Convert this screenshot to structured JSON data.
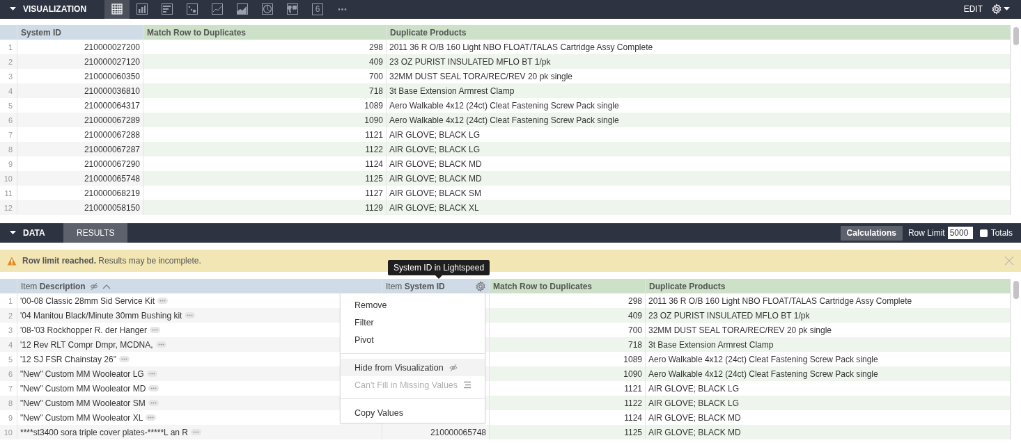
{
  "visualization": {
    "title": "VISUALIZATION",
    "expanded": true,
    "toolbar": [
      {
        "kind": "table",
        "selected": true
      },
      {
        "kind": "column",
        "selected": false
      },
      {
        "kind": "bar",
        "selected": false
      },
      {
        "kind": "scatter",
        "selected": false
      },
      {
        "kind": "line",
        "selected": false
      },
      {
        "kind": "area",
        "selected": false
      },
      {
        "kind": "pie",
        "selected": false
      },
      {
        "kind": "map",
        "selected": false
      },
      {
        "kind": "single_value",
        "label": "6",
        "selected": false
      },
      {
        "kind": "more",
        "label": "•••",
        "selected": false
      }
    ],
    "edit_label": "EDIT"
  },
  "visualization_table": {
    "columns": [
      {
        "label": "System ID",
        "kind": "dimension"
      },
      {
        "label": "Match Row to Duplicates",
        "kind": "measure"
      },
      {
        "label": "Duplicate Products",
        "kind": "measure"
      }
    ],
    "rows": [
      {
        "number": "1",
        "cells": [
          "210000027200",
          "298",
          "2011 36 R O/B 160 Light NBO FLOAT/TALAS Cartridge Assy Complete"
        ]
      },
      {
        "number": "2",
        "cells": [
          "210000027120",
          "409",
          "23 OZ PURIST INSULATED MFLO BT 1/pk"
        ]
      },
      {
        "number": "3",
        "cells": [
          "210000060350",
          "700",
          "32MM DUST SEAL TORA/REC/REV 20 pk single"
        ]
      },
      {
        "number": "4",
        "cells": [
          "210000036810",
          "718",
          "3t Base Extension Armrest Clamp"
        ]
      },
      {
        "number": "5",
        "cells": [
          "210000064317",
          "1089",
          "Aero Walkable 4x12 (24ct) Cleat Fastening Screw Pack single"
        ]
      },
      {
        "number": "6",
        "cells": [
          "210000067289",
          "1090",
          "Aero Walkable 4x12 (24ct) Cleat Fastening Screw Pack single"
        ]
      },
      {
        "number": "7",
        "cells": [
          "210000067288",
          "1121",
          "AIR GLOVE; BLACK LG"
        ]
      },
      {
        "number": "8",
        "cells": [
          "210000067287",
          "1122",
          "AIR GLOVE; BLACK LG"
        ]
      },
      {
        "number": "9",
        "cells": [
          "210000067290",
          "1124",
          "AIR GLOVE; BLACK MD"
        ]
      },
      {
        "number": "10",
        "cells": [
          "210000065748",
          "1125",
          "AIR GLOVE; BLACK MD"
        ]
      },
      {
        "number": "11",
        "cells": [
          "210000068219",
          "1127",
          "AIR GLOVE; BLACK SM"
        ]
      },
      {
        "number": "12",
        "cells": [
          "210000058150",
          "1129",
          "AIR GLOVE; BLACK XL"
        ]
      }
    ]
  },
  "data_panel": {
    "title": "DATA",
    "expanded": true,
    "tabs": [
      {
        "label": "RESULTS",
        "selected": true
      }
    ],
    "calculations_button": "Calculations",
    "row_limit": {
      "label": "Row Limit",
      "value": "5000"
    },
    "totals": {
      "label": "Totals",
      "checked": false
    }
  },
  "banner": {
    "text": "**Row limit reached.** Results may be incomplete."
  },
  "tooltip": "System ID in Lightspeed",
  "results_table": {
    "columns": [
      {
        "label": "Item **Description**",
        "kind": "dimension",
        "hidden_in_visualization": true,
        "sort_ascending": true,
        "detail_menu": true
      },
      {
        "label": "Item **System ID**",
        "kind": "dimension",
        "settings_shown": true
      },
      {
        "label": "Match Row to Duplicates",
        "kind": "measure"
      },
      {
        "label": "Duplicate Products",
        "kind": "measure"
      }
    ],
    "rows": [
      {
        "number": "1",
        "cells": [
          "'00-08 Classic 28mm Sid Service Kit",
          null,
          "298",
          "2011 36 R O/B 160 Light NBO FLOAT/TALAS Cartridge Assy Complete"
        ]
      },
      {
        "number": "2",
        "cells": [
          "'04 Manitou Black/Minute 30mm Bushing kit",
          null,
          "409",
          "23 OZ PURIST INSULATED MFLO BT 1/pk"
        ]
      },
      {
        "number": "3",
        "cells": [
          "'08-'03 Rockhopper R. der Hanger",
          null,
          "700",
          "32MM DUST SEAL TORA/REC/REV 20 pk single"
        ]
      },
      {
        "number": "4",
        "cells": [
          "'12 Rev RLT Compr Dmpr, MCDNA,",
          null,
          "718",
          "3t Base Extension Armrest Clamp"
        ]
      },
      {
        "number": "5",
        "cells": [
          "'12 SJ FSR Chainstay 26\"",
          null,
          "1089",
          "Aero Walkable 4x12 (24ct) Cleat Fastening Screw Pack single"
        ]
      },
      {
        "number": "6",
        "cells": [
          "\"New\" Custom MM Wooleator LG",
          null,
          "1090",
          "Aero Walkable 4x12 (24ct) Cleat Fastening Screw Pack single"
        ]
      },
      {
        "number": "7",
        "cells": [
          "\"New\" Custom MM Wooleator MD",
          null,
          "1121",
          "AIR GLOVE; BLACK LG"
        ]
      },
      {
        "number": "8",
        "cells": [
          "\"New\" Custom MM Wooleator SM",
          null,
          "1122",
          "AIR GLOVE; BLACK LG"
        ]
      },
      {
        "number": "9",
        "cells": [
          "\"New\" Custom MM Wooleator XL",
          null,
          "1124",
          "AIR GLOVE; BLACK MD"
        ]
      },
      {
        "number": "10",
        "cells": [
          "****st3400 sora triple cover plates-*****L an R",
          "210000065748",
          "1125",
          "AIR GLOVE; BLACK MD"
        ]
      }
    ]
  },
  "context_menu": {
    "items": [
      {
        "kind": "item",
        "label": "Remove",
        "highlighted": false,
        "disabled": false
      },
      {
        "kind": "item",
        "label": "Filter",
        "highlighted": false,
        "disabled": false
      },
      {
        "kind": "item",
        "label": "Pivot",
        "highlighted": false,
        "disabled": false
      },
      {
        "kind": "divider"
      },
      {
        "kind": "eye_item",
        "label": "Hide from Visualization",
        "highlighted": true,
        "disabled": false
      },
      {
        "kind": "lines_item",
        "label": "Can't Fill in Missing Values",
        "highlighted": false,
        "disabled": true
      },
      {
        "kind": "divider"
      },
      {
        "kind": "item",
        "label": "Copy Values",
        "highlighted": false,
        "disabled": false
      }
    ]
  }
}
